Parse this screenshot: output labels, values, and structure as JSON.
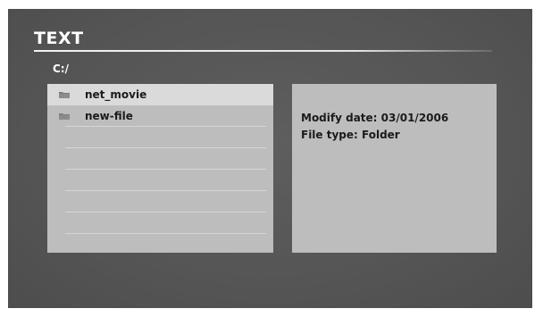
{
  "header": {
    "title": "TEXT"
  },
  "path": {
    "current": "C:/"
  },
  "file_list": {
    "items": [
      {
        "name": "net_movie",
        "icon": "folder-icon",
        "selected": true
      },
      {
        "name": "new-file",
        "icon": "folder-icon",
        "selected": false
      }
    ],
    "empty_rows": 6
  },
  "info_panel": {
    "modify_date": "Modify date: 03/01/2006",
    "file_type": "File type: Folder"
  },
  "colors": {
    "background": "#555555",
    "panel": "#bdbdbd",
    "selected_row": "#dadada",
    "text_light": "#ffffff",
    "text_dark": "#1b1b1b"
  }
}
